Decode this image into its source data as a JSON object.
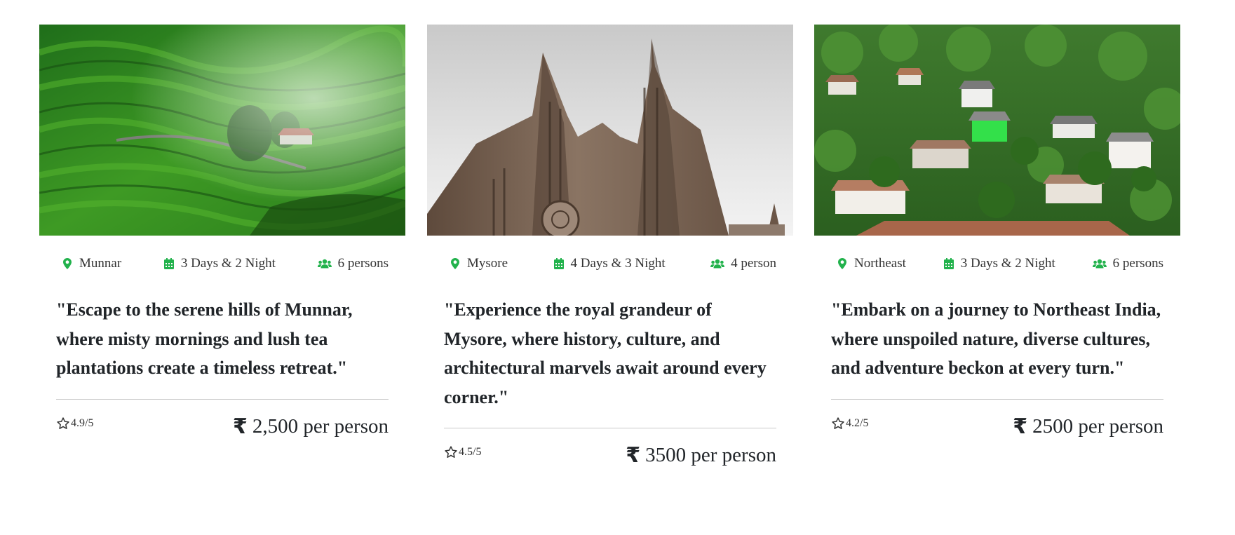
{
  "colors": {
    "accent": "#22b24c",
    "text": "#212529",
    "divider": "#c9c9c9"
  },
  "icons": {
    "location": "map-pin-icon",
    "duration": "calendar-icon",
    "persons": "users-icon",
    "rating": "star-outline-icon",
    "currency": "rupee-icon"
  },
  "currency_symbol": "₹",
  "cards": [
    {
      "location": "Munnar",
      "duration": "3 Days & 2 Night",
      "persons": "6 persons",
      "description": "\"Escape to the serene hills of Munnar, where misty mornings and lush tea plantations create a timeless retreat.\"",
      "rating": "4.9/5",
      "price": "2,500 per person",
      "image": "tea-plantation-hills-photo"
    },
    {
      "location": "Mysore",
      "duration": "4 Days & 3 Night",
      "persons": "4 person",
      "description": "\"Experience the royal grandeur of Mysore, where history, culture, and architectural marvels await around every corner.\"",
      "rating": "4.5/5",
      "price": "3500 per person",
      "image": "gothic-cathedral-photo"
    },
    {
      "location": "Northeast",
      "duration": "3 Days & 2 Night",
      "persons": "6 persons",
      "description": "\"Embark on a journey to Northeast India, where unspoiled nature, diverse cultures, and adventure beckon at every turn.\"",
      "rating": "4.2/5",
      "price": "2500 per person",
      "image": "hillside-village-photo"
    }
  ]
}
